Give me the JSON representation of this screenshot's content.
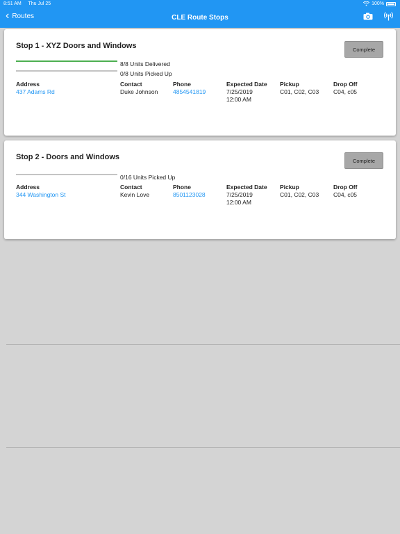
{
  "status_bar": {
    "time": "8:51 AM",
    "date": "Thu Jul 25",
    "battery": "100%"
  },
  "nav": {
    "back_label": "Routes",
    "title": "CLE Route Stops"
  },
  "columns": {
    "address": "Address",
    "contact": "Contact",
    "phone": "Phone",
    "expected_date": "Expected Date",
    "pickup": "Pickup",
    "drop_off": "Drop Off"
  },
  "stops": [
    {
      "title": "Stop 1 - XYZ Doors and Windows",
      "button": "Complete",
      "delivered_label": "8/8 Units Delivered",
      "delivered_progress": 1.0,
      "picked_label": "0/8 Units Picked Up",
      "picked_progress": 0.0,
      "address": "437 Adams Rd",
      "contact": "Duke Johnson",
      "phone": "4854541819",
      "date": "7/25/2019",
      "time": "12:00 AM",
      "pickup": "C01, C02, C03",
      "drop_off": "C04, c05"
    },
    {
      "title": "Stop 2 - Doors and Windows",
      "button": "Complete",
      "picked_label": "0/16 Units Picked Up",
      "picked_progress": 0.0,
      "address": "344 Washington St",
      "contact": "Kevin Love",
      "phone": "8501123028",
      "date": "7/25/2019",
      "time": "12:00 AM",
      "pickup": "C01, C02, C03",
      "drop_off": "C04, c05"
    }
  ],
  "colors": {
    "accent": "#2196f3",
    "progress_fill": "#4caf50",
    "progress_track": "#c4c4c4",
    "button_bg": "#a7a7a7",
    "background": "#d4d4d4"
  }
}
